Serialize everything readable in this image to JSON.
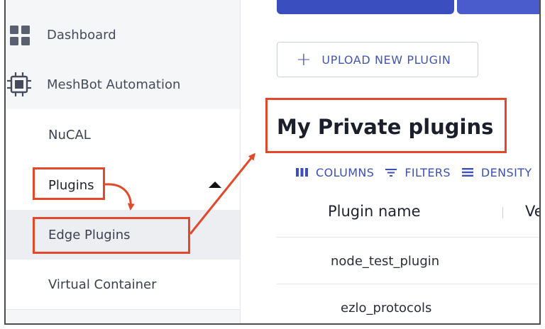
{
  "sidebar": {
    "items": [
      {
        "label": "Dashboard",
        "icon": "grid-icon"
      },
      {
        "label": "MeshBot Automation",
        "icon": "chip-icon"
      },
      {
        "label": "NuCAL"
      },
      {
        "label": "Plugins"
      },
      {
        "label": "Edge Plugins"
      },
      {
        "label": "Virtual Container"
      }
    ]
  },
  "main": {
    "upload_button": {
      "icon": "plus-icon",
      "label": "UPLOAD NEW PLUGIN"
    },
    "page_title": "My Private plugins",
    "toolbar": {
      "columns": "COLUMNS",
      "filters": "FILTERS",
      "density": "DENSITY"
    },
    "table": {
      "columns": [
        "Plugin name",
        "Ve"
      ],
      "rows": [
        {
          "plugin_name": "node_test_plugin"
        },
        {
          "plugin_name": "ezlo_protocols"
        }
      ]
    }
  },
  "colors": {
    "accent": "#3d50b6",
    "highlight": "#e2492b",
    "sidebar_bg": "#f5f6f8"
  }
}
